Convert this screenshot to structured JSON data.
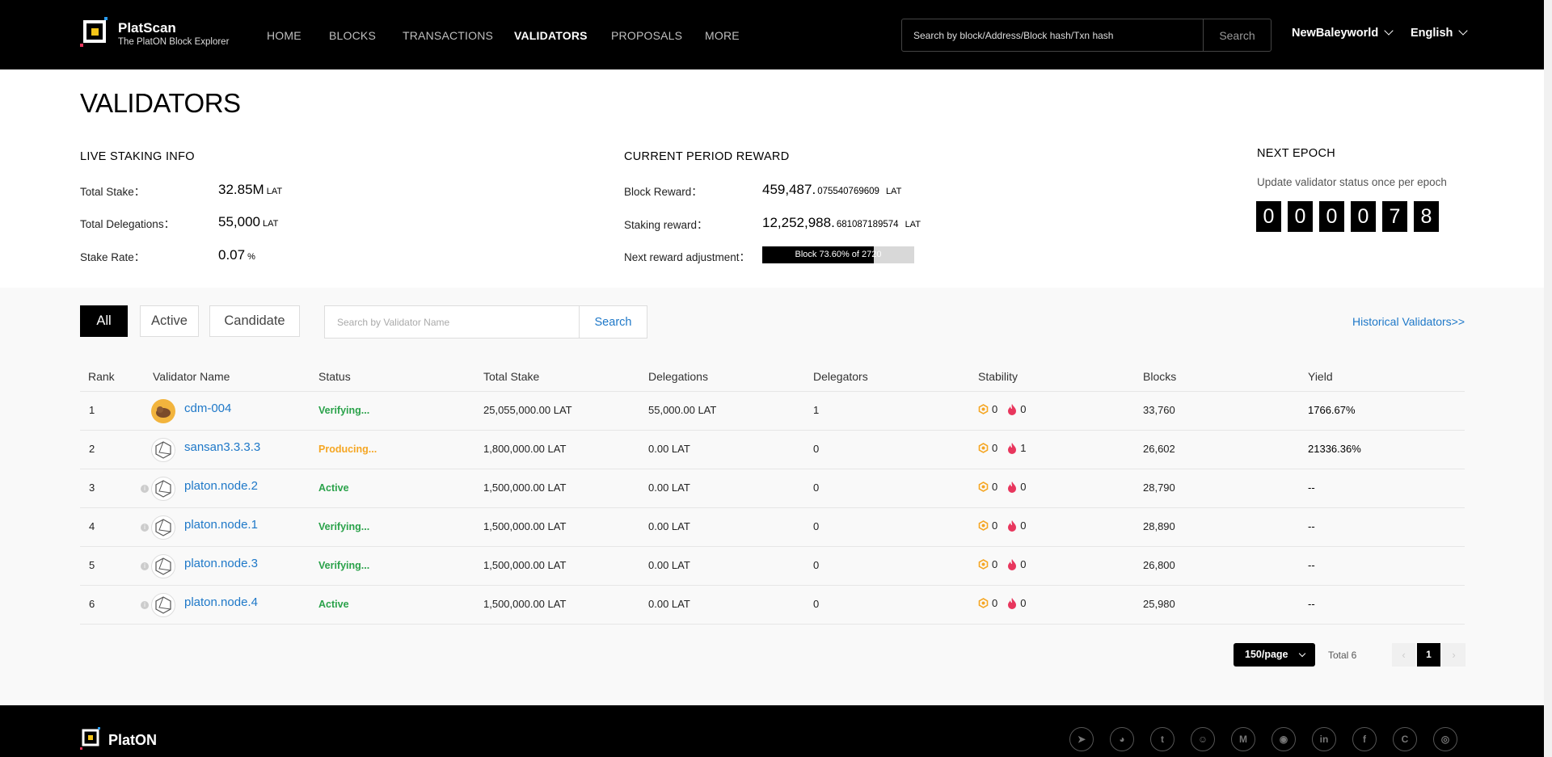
{
  "header": {
    "logo_title": "PlatScan",
    "logo_subtitle": "The PlatON Block Explorer",
    "nav": [
      "HOME",
      "BLOCKS",
      "TRANSACTIONS",
      "VALIDATORS",
      "PROPOSALS",
      "MORE"
    ],
    "active_nav": "VALIDATORS",
    "search_placeholder": "Search by block/Address/Block hash/Txn hash",
    "search_button": "Search",
    "network": "NewBaleyworld",
    "language": "English"
  },
  "page_title": "VALIDATORS",
  "live_staking": {
    "title": "LIVE STAKING INFO",
    "total_stake_label": "Total Stake：",
    "total_stake_value": "32.85M",
    "total_stake_unit": "LAT",
    "total_delegations_label": "Total Delegations：",
    "total_delegations_value": "55,000",
    "total_delegations_unit": "LAT",
    "stake_rate_label": "Stake Rate：",
    "stake_rate_value": "0.07",
    "stake_rate_unit": "%"
  },
  "period_reward": {
    "title": "CURRENT PERIOD REWARD",
    "block_reward_label": "Block Reward：",
    "block_reward_int": "459,487.",
    "block_reward_dec": "075540769609",
    "block_reward_unit": "LAT",
    "staking_reward_label": "Staking reward：",
    "staking_reward_int": "12,252,988.",
    "staking_reward_dec": "681087189574",
    "staking_reward_unit": "LAT",
    "next_adjust_label": "Next reward adjustment：",
    "progress_text": "Block 73.60% of 2720",
    "progress_fraction": 0.736
  },
  "next_epoch": {
    "title": "NEXT EPOCH",
    "description": "Update validator status once per epoch",
    "digits": [
      "0",
      "0",
      "0",
      "0",
      "7",
      "8"
    ]
  },
  "filters": {
    "tabs": [
      "All",
      "Active",
      "Candidate"
    ],
    "active_tab": "All",
    "search_placeholder": "Search by Validator Name",
    "search_button": "Search",
    "historical_link": "Historical Validators>>"
  },
  "table": {
    "columns": [
      "Rank",
      "Validator Name",
      "Status",
      "Total Stake",
      "Delegations",
      "Delegators",
      "Stability",
      "Blocks",
      "Yield"
    ],
    "rows": [
      {
        "rank": "1",
        "name": "cdm-004",
        "avatar": "gold",
        "info": false,
        "status": "Verifying...",
        "status_color": "#2aa24a",
        "total_stake": "25,055,000.00 LAT",
        "delegations": "55,000.00 LAT",
        "delegators": "1",
        "stab_a": "0",
        "stab_b": "0",
        "blocks": "33,760",
        "yield": "1766.67%"
      },
      {
        "rank": "2",
        "name": "sansan3.3.3.3",
        "avatar": "plain",
        "info": false,
        "status": "Producing...",
        "status_color": "#f5a623",
        "total_stake": "1,800,000.00 LAT",
        "delegations": "0.00 LAT",
        "delegators": "0",
        "stab_a": "0",
        "stab_b": "1",
        "blocks": "26,602",
        "yield": "21336.36%"
      },
      {
        "rank": "3",
        "name": "platon.node.2",
        "avatar": "plain",
        "info": true,
        "status": "Active",
        "status_color": "#2aa24a",
        "total_stake": "1,500,000.00 LAT",
        "delegations": "0.00 LAT",
        "delegators": "0",
        "stab_a": "0",
        "stab_b": "0",
        "blocks": "28,790",
        "yield": "--"
      },
      {
        "rank": "4",
        "name": "platon.node.1",
        "avatar": "plain",
        "info": true,
        "status": "Verifying...",
        "status_color": "#2aa24a",
        "total_stake": "1,500,000.00 LAT",
        "delegations": "0.00 LAT",
        "delegators": "0",
        "stab_a": "0",
        "stab_b": "0",
        "blocks": "28,890",
        "yield": "--"
      },
      {
        "rank": "5",
        "name": "platon.node.3",
        "avatar": "plain",
        "info": true,
        "status": "Verifying...",
        "status_color": "#2aa24a",
        "total_stake": "1,500,000.00 LAT",
        "delegations": "0.00 LAT",
        "delegators": "0",
        "stab_a": "0",
        "stab_b": "0",
        "blocks": "26,800",
        "yield": "--"
      },
      {
        "rank": "6",
        "name": "platon.node.4",
        "avatar": "plain",
        "info": true,
        "status": "Active",
        "status_color": "#2aa24a",
        "total_stake": "1,500,000.00 LAT",
        "delegations": "0.00 LAT",
        "delegators": "0",
        "stab_a": "0",
        "stab_b": "0",
        "blocks": "25,980",
        "yield": "--"
      }
    ]
  },
  "pagination": {
    "page_size": "150/page",
    "total": "Total 6",
    "current_page": "1",
    "prev": "‹",
    "next": "›"
  },
  "footer": {
    "brand": "PlatON",
    "socials": [
      "telegram-icon",
      "wechat-icon",
      "twitter-icon",
      "reddit-icon",
      "medium-icon",
      "github-icon",
      "linkedin-icon",
      "facebook-icon",
      "coinmarketcap-icon",
      "other-icon"
    ]
  },
  "colors": {
    "link": "#1e78c8",
    "status_green": "#2aa24a",
    "status_orange": "#f5a623",
    "stability_gold": "#f5a623",
    "stability_red": "#e8365d"
  }
}
